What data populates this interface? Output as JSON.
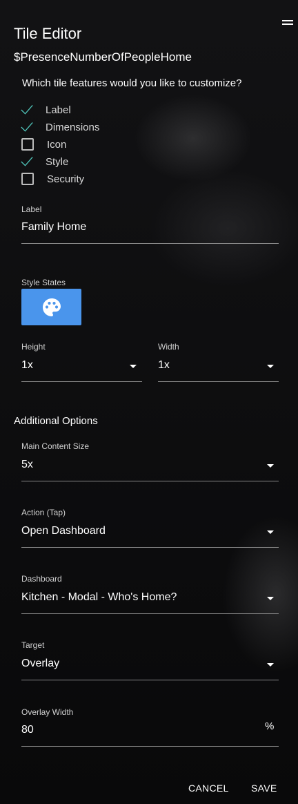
{
  "editor": {
    "title": "Tile Editor",
    "subtitle": "$PresenceNumberOfPeopleHome",
    "question": "Which tile features would you like to customize?"
  },
  "features": [
    {
      "label": "Label",
      "checked": true
    },
    {
      "label": "Dimensions",
      "checked": true
    },
    {
      "label": "Icon",
      "checked": false
    },
    {
      "label": "Style",
      "checked": true
    },
    {
      "label": "Security",
      "checked": false
    }
  ],
  "label_field": {
    "label": "Label",
    "value": "Family Home"
  },
  "style_states": {
    "label": "Style States",
    "icon": "palette-icon",
    "color": "#4a95ec"
  },
  "height_field": {
    "label": "Height",
    "value": "1x"
  },
  "width_field": {
    "label": "Width",
    "value": "1x"
  },
  "additional": {
    "title": "Additional Options"
  },
  "main_content_size": {
    "label": "Main Content Size",
    "value": "5x"
  },
  "action": {
    "label": "Action (Tap)",
    "value": "Open Dashboard"
  },
  "dashboard": {
    "label": "Dashboard",
    "value": "Kitchen - Modal - Who's Home?"
  },
  "target": {
    "label": "Target",
    "value": "Overlay"
  },
  "overlay_width": {
    "label": "Overlay Width",
    "value": "80",
    "unit": "%"
  },
  "buttons": {
    "cancel": "CANCEL",
    "save": "SAVE"
  },
  "colors": {
    "check": "#4fc3b8",
    "accent": "#4a95ec",
    "background": "#0b0b0c"
  }
}
